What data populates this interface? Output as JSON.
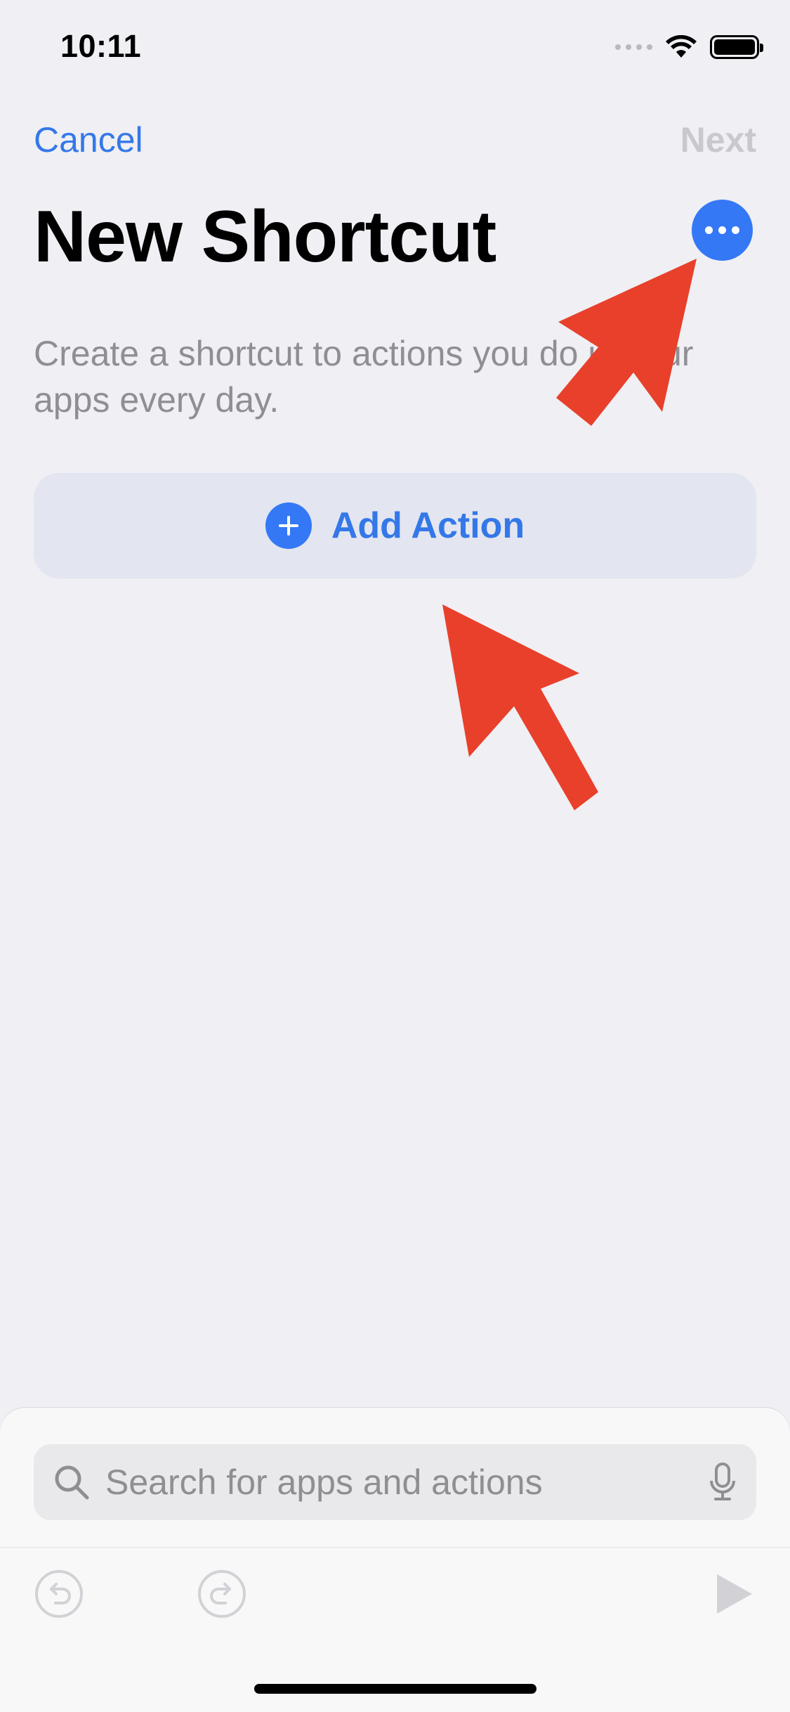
{
  "status_bar": {
    "time": "10:11"
  },
  "nav": {
    "cancel_label": "Cancel",
    "next_label": "Next"
  },
  "header": {
    "title": "New Shortcut"
  },
  "main": {
    "description": "Create a shortcut to actions you do in your apps every day.",
    "add_action_label": "Add Action"
  },
  "search": {
    "placeholder": "Search for apps and actions"
  },
  "colors": {
    "accent": "#3478f6",
    "annotation_arrow": "#e8402a",
    "background": "#efeff4"
  },
  "icons": {
    "more": "ellipsis-icon",
    "add": "plus-circle-icon",
    "search": "magnifier-icon",
    "mic": "microphone-icon",
    "undo": "undo-icon",
    "redo": "redo-icon",
    "play": "play-icon"
  }
}
